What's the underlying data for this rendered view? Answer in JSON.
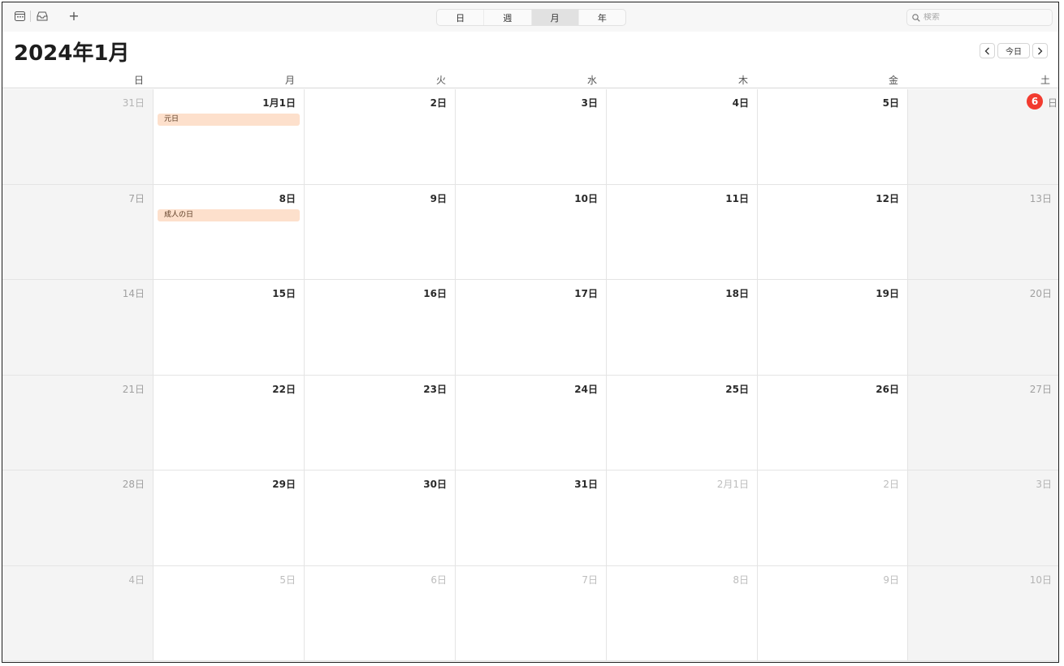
{
  "toolbar": {
    "icons": {
      "calendar": "calendar-icon",
      "inbox": "inbox-icon",
      "add": "+"
    },
    "views": [
      {
        "label": "日",
        "active": false
      },
      {
        "label": "週",
        "active": false
      },
      {
        "label": "月",
        "active": true
      },
      {
        "label": "年",
        "active": false
      }
    ],
    "search_placeholder": "検索"
  },
  "header": {
    "title": "2024年1月",
    "prev_label": "〈",
    "today_label": "今日",
    "next_label": "〉"
  },
  "weekdays": [
    "日",
    "月",
    "火",
    "水",
    "木",
    "金",
    "土"
  ],
  "colors": {
    "today_badge": "#f23b2f",
    "event_bg": "#fde0cc",
    "weekend_bg": "#f4f4f4"
  },
  "weeks": [
    [
      {
        "label": "31日",
        "other": true
      },
      {
        "label": "1月1日",
        "event": "元日"
      },
      {
        "label": "2日"
      },
      {
        "label": "3日"
      },
      {
        "label": "4日"
      },
      {
        "label": "5日"
      },
      {
        "label": "日",
        "today": true,
        "today_num": "6"
      }
    ],
    [
      {
        "label": "7日"
      },
      {
        "label": "8日",
        "event": "成人の日"
      },
      {
        "label": "9日"
      },
      {
        "label": "10日"
      },
      {
        "label": "11日"
      },
      {
        "label": "12日"
      },
      {
        "label": "13日"
      }
    ],
    [
      {
        "label": "14日"
      },
      {
        "label": "15日"
      },
      {
        "label": "16日"
      },
      {
        "label": "17日"
      },
      {
        "label": "18日"
      },
      {
        "label": "19日"
      },
      {
        "label": "20日"
      }
    ],
    [
      {
        "label": "21日"
      },
      {
        "label": "22日"
      },
      {
        "label": "23日"
      },
      {
        "label": "24日"
      },
      {
        "label": "25日"
      },
      {
        "label": "26日"
      },
      {
        "label": "27日"
      }
    ],
    [
      {
        "label": "28日"
      },
      {
        "label": "29日"
      },
      {
        "label": "30日"
      },
      {
        "label": "31日"
      },
      {
        "label": "2月1日",
        "other": true
      },
      {
        "label": "2日",
        "other": true
      },
      {
        "label": "3日",
        "other": true
      }
    ],
    [
      {
        "label": "4日",
        "other": true
      },
      {
        "label": "5日",
        "other": true
      },
      {
        "label": "6日",
        "other": true
      },
      {
        "label": "7日",
        "other": true
      },
      {
        "label": "8日",
        "other": true
      },
      {
        "label": "9日",
        "other": true
      },
      {
        "label": "10日",
        "other": true
      }
    ]
  ]
}
